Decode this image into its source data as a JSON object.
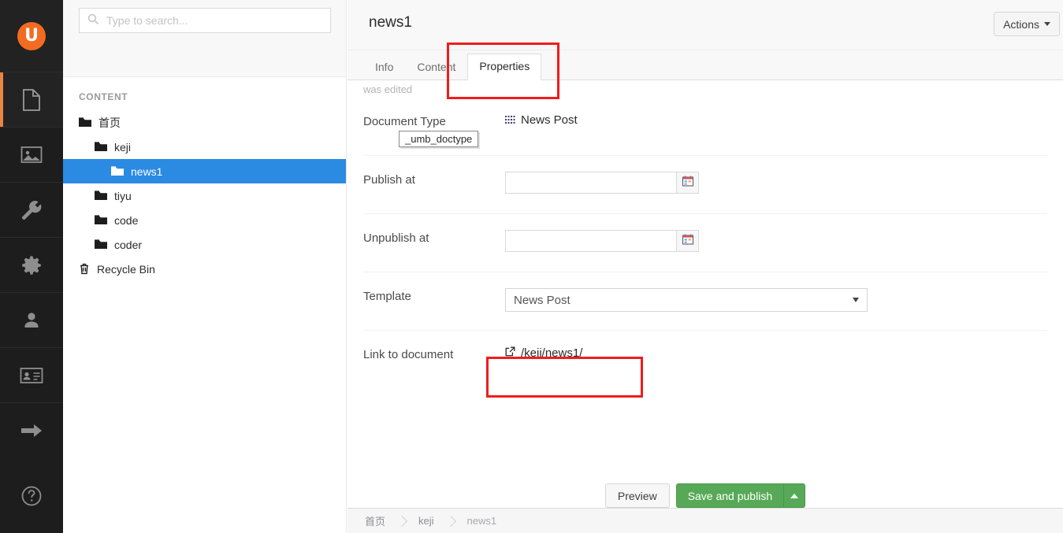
{
  "rail": {
    "logo_label": "U",
    "items": [
      {
        "name": "content",
        "icon": "document-icon",
        "active": true
      },
      {
        "name": "media",
        "icon": "image-icon",
        "active": false
      },
      {
        "name": "settings-tools",
        "icon": "wrench-icon",
        "active": false
      },
      {
        "name": "developer",
        "icon": "gear-icon",
        "active": false
      },
      {
        "name": "users",
        "icon": "user-icon",
        "active": false
      },
      {
        "name": "members",
        "icon": "id-card-icon",
        "active": false
      },
      {
        "name": "forms",
        "icon": "arrow-right-icon",
        "active": false
      },
      {
        "name": "help",
        "icon": "question-circle-icon",
        "active": false
      }
    ]
  },
  "search": {
    "placeholder": "Type to search...",
    "value": ""
  },
  "tree": {
    "section_title": "CONTENT",
    "nodes": [
      {
        "label": "首页",
        "level": 0,
        "icon": "folder-icon",
        "selected": false,
        "cjk": true
      },
      {
        "label": "keji",
        "level": 1,
        "icon": "folder-icon",
        "selected": false,
        "cjk": false
      },
      {
        "label": "news1",
        "level": 2,
        "icon": "folder-icon",
        "selected": true,
        "cjk": false
      },
      {
        "label": "tiyu",
        "level": 1,
        "icon": "folder-icon",
        "selected": false,
        "cjk": false
      },
      {
        "label": "code",
        "level": 1,
        "icon": "folder-icon",
        "selected": false,
        "cjk": false
      },
      {
        "label": "coder",
        "level": 1,
        "icon": "folder-icon",
        "selected": false,
        "cjk": false
      },
      {
        "label": "Recycle Bin",
        "level": 0,
        "icon": "trash-icon",
        "selected": false,
        "cjk": false
      }
    ]
  },
  "editor": {
    "title_value": "news1",
    "actions_label": "Actions",
    "edited_note": "was edited",
    "tabs": [
      {
        "label": "Info",
        "active": false
      },
      {
        "label": "Content",
        "active": false
      },
      {
        "label": "Properties",
        "active": true
      }
    ],
    "properties": {
      "document_type": {
        "label": "Document Type",
        "value": "News Post",
        "icon": "grid-dots-icon",
        "tooltip": "_umb_doctype"
      },
      "publish_at": {
        "label": "Publish at",
        "value": "",
        "icon": "calendar-icon"
      },
      "unpublish_at": {
        "label": "Unpublish at",
        "value": "",
        "icon": "calendar-icon"
      },
      "template": {
        "label": "Template",
        "selected": "News Post",
        "options": [
          "News Post"
        ]
      },
      "link_to_document": {
        "label": "Link to document",
        "value": "/keji/news1/",
        "icon": "external-link-icon"
      }
    }
  },
  "footer": {
    "preview_label": "Preview",
    "publish_label": "Save and publish",
    "breadcrumb": [
      {
        "label": "首页",
        "cjk": true
      },
      {
        "label": "keji",
        "cjk": false
      },
      {
        "label": "news1",
        "cjk": false
      }
    ]
  },
  "colors": {
    "brand_orange": "#f36b21",
    "selection_blue": "#2b8ae2",
    "publish_green": "#57a957",
    "annotation_red": "#f01c1c",
    "rail_dark": "#1d1d1d"
  }
}
